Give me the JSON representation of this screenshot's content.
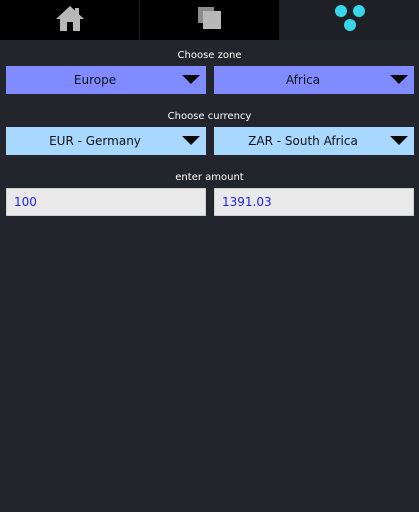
{
  "tabs": [
    {
      "icon": "home-icon"
    },
    {
      "icon": "documents-icon"
    },
    {
      "icon": "dots-icon"
    }
  ],
  "labels": {
    "choose_zone": "Choose zone",
    "choose_currency": "Choose currency",
    "enter_amount": "enter amount"
  },
  "zone": {
    "from": "Europe",
    "to": "Africa"
  },
  "currency": {
    "from": "EUR - Germany",
    "to": "ZAR - South Africa"
  },
  "amount": {
    "from": "100",
    "to": "1391.03"
  },
  "colors": {
    "background": "#23252d",
    "zone_dropdown": "#7f8bff",
    "currency_dropdown": "#a8d7ff",
    "amount_text": "#1f22e6",
    "accent_icon": "#37d6e8"
  }
}
